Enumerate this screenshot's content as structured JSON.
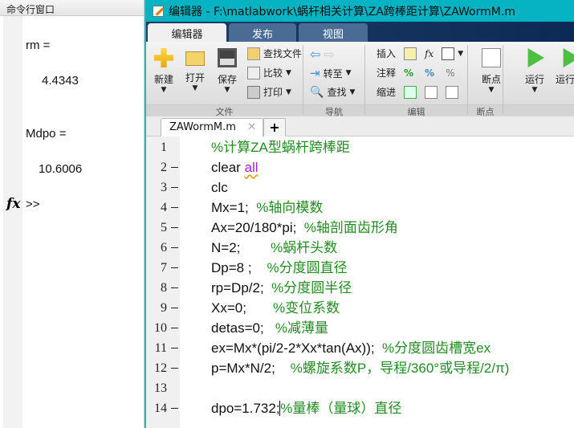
{
  "command_window": {
    "title": "命令行窗口",
    "lines": [
      "rm =",
      "4.4343",
      "Mdpo =",
      "10.6006"
    ],
    "prompt": ">>",
    "fx_icon": "fx"
  },
  "editor": {
    "title": "编辑器 - F:\\matlabwork\\蜗杆相关计算\\ZA跨棒距计算\\ZAWormM.m",
    "tabs": [
      "编辑器",
      "发布",
      "视图"
    ],
    "ribbon": {
      "new": "新建",
      "open": "打开",
      "save": "保存",
      "find_files": "查找文件",
      "compare": "比较",
      "print": "打印",
      "goto": "转至",
      "find": "查找",
      "insert": "插入",
      "comment": "注释",
      "indent": "缩进",
      "breakpoints": "断点",
      "run": "运行",
      "run_advance": "运行前",
      "groups": [
        "文件",
        "导航",
        "编辑",
        "断点"
      ]
    },
    "file_tab": "ZAWormM.m",
    "lines": [
      {
        "n": "1",
        "code": "",
        "comment": "%计算ZA型蜗杆跨棒距"
      },
      {
        "n": "2",
        "code": "clear ",
        "kw": "all",
        "comment": ""
      },
      {
        "n": "3",
        "code": "clc",
        "comment": ""
      },
      {
        "n": "4",
        "code": "Mx=1;  ",
        "comment": "%轴向模数"
      },
      {
        "n": "5",
        "code": "Ax=20/180*pi;  ",
        "comment": "%轴剖面齿形角"
      },
      {
        "n": "6",
        "code": "N=2;        ",
        "comment": "%蜗杆头数"
      },
      {
        "n": "7",
        "code": "Dp=8 ;    ",
        "comment": "%分度圆直径"
      },
      {
        "n": "8",
        "code": "rp=Dp/2;  ",
        "comment": "%分度圆半径"
      },
      {
        "n": "9",
        "code": "Xx=0;       ",
        "comment": "%变位系数"
      },
      {
        "n": "10",
        "code": "detas=0;   ",
        "comment": "%减薄量"
      },
      {
        "n": "11",
        "code": "ex=Mx*(pi/2-2*Xx*tan(Ax));  ",
        "comment": "%分度圆齿槽宽ex"
      },
      {
        "n": "12",
        "code": "p=Mx*N/2;    ",
        "comment": "%螺旋系数P，导程/360°或导程/2/π)"
      },
      {
        "n": "13",
        "code": "",
        "comment": ""
      },
      {
        "n": "14",
        "code": "dpo=1.732; ",
        "comment": "%量棒（量球）直径"
      }
    ]
  },
  "colors": {
    "titlebar": "#05b3c3",
    "comment": "#228b22",
    "keyword": "#a020f0"
  }
}
